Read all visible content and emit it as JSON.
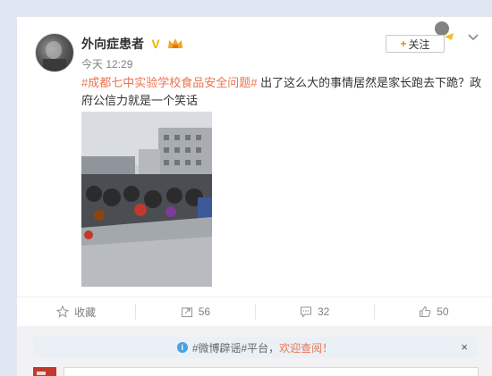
{
  "post": {
    "username": "外向症患者",
    "verify_icon": "V",
    "time": "今天 12:29",
    "hashtag": "#成都七中实验学校食品安全问题#",
    "text": " 出了这么大的事情居然是家长跑去下跪？政府公信力就是一个笑话"
  },
  "follow": {
    "plus": "+",
    "label": "关注"
  },
  "actions": {
    "favorite_label": "收藏",
    "forward_count": "56",
    "comment_count": "32",
    "like_count": "50"
  },
  "notice": {
    "info_icon": "i",
    "text_plain": "#微博辟谣#平台，",
    "text_link": "欢迎查阅！",
    "close": "×"
  },
  "colors": {
    "accent": "#eb7350",
    "follow_plus": "#ff8200",
    "verify": "#f0b400",
    "notice_bg": "#eaf0f6"
  }
}
